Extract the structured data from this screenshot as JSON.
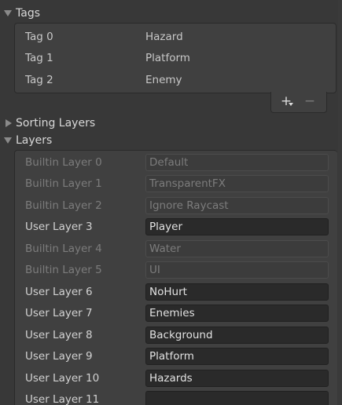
{
  "tags": {
    "header": "Tags",
    "items": [
      {
        "name": "Tag 0",
        "value": "Hazard"
      },
      {
        "name": "Tag 1",
        "value": "Platform"
      },
      {
        "name": "Tag 2",
        "value": "Enemy"
      }
    ],
    "add_symbol": "+",
    "remove_symbol": "−"
  },
  "sorting_layers": {
    "header": "Sorting Layers"
  },
  "layers": {
    "header": "Layers",
    "items": [
      {
        "name": "Builtin Layer 0",
        "value": "Default",
        "editable": false
      },
      {
        "name": "Builtin Layer 1",
        "value": "TransparentFX",
        "editable": false
      },
      {
        "name": "Builtin Layer 2",
        "value": "Ignore Raycast",
        "editable": false
      },
      {
        "name": "User Layer 3",
        "value": "Player",
        "editable": true
      },
      {
        "name": "Builtin Layer 4",
        "value": "Water",
        "editable": false
      },
      {
        "name": "Builtin Layer 5",
        "value": "UI",
        "editable": false
      },
      {
        "name": "User Layer 6",
        "value": "NoHurt",
        "editable": true
      },
      {
        "name": "User Layer 7",
        "value": "Enemies",
        "editable": true
      },
      {
        "name": "User Layer 8",
        "value": "Background",
        "editable": true
      },
      {
        "name": "User Layer 9",
        "value": "Platform",
        "editable": true
      },
      {
        "name": "User Layer 10",
        "value": "Hazards",
        "editable": true
      },
      {
        "name": "User Layer 11",
        "value": "",
        "editable": true
      }
    ]
  },
  "colors": {
    "panel_bg": "#383838",
    "list_bg": "#404040",
    "field_bg": "#2a2a2a",
    "text": "#d2d2d2",
    "text_disabled": "#7c7c7c"
  }
}
